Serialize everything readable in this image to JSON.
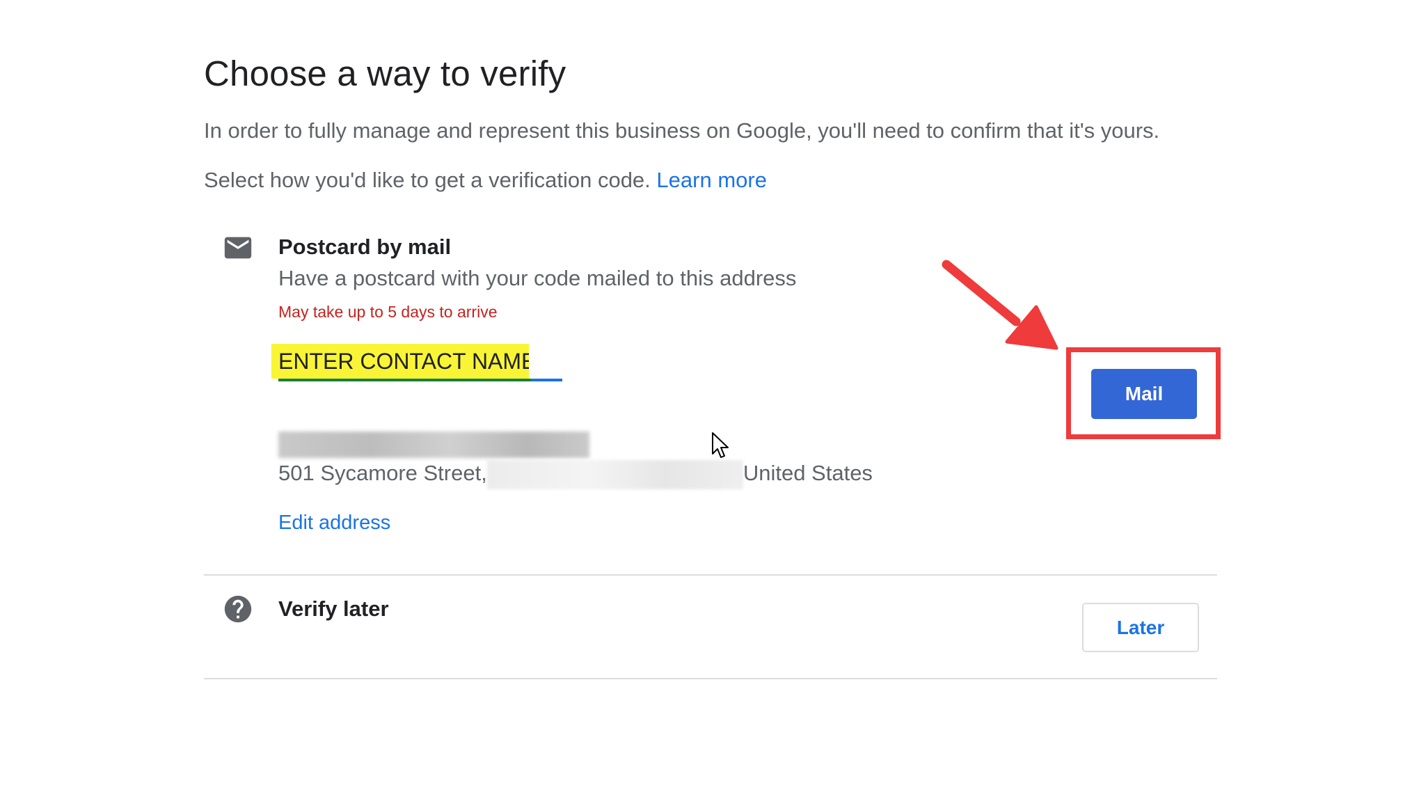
{
  "header": {
    "title": "Choose a way to verify",
    "intro": "In order to fully manage and represent this business on Google, you'll need to confirm that it's yours.",
    "select_text": "Select how you'd like to get a verification code.",
    "learn_more_label": "Learn more"
  },
  "options": {
    "postcard": {
      "icon": "mail-icon",
      "title": "Postcard by mail",
      "description": "Have a postcard with your code mailed to this address",
      "note": "May take up to 5 days to arrive",
      "contact_name_value": "ENTER CONTACT NAME",
      "address_street": "501 Sycamore Street,",
      "address_country": "United States",
      "edit_address_label": "Edit address",
      "action_label": "Mail"
    },
    "later": {
      "icon": "help-circle-icon",
      "title": "Verify later",
      "action_label": "Later"
    }
  },
  "colors": {
    "primary_blue": "#3367d6",
    "link_blue": "#1a73e8",
    "note_red": "#c5221f",
    "annotation_red": "#ef3b3b",
    "highlight_yellow": "#f9f536"
  }
}
